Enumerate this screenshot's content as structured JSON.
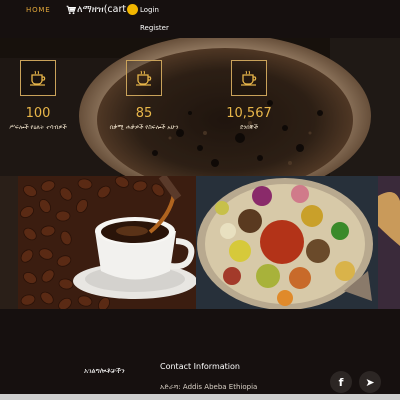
{
  "header": {
    "nav_home": "HOME",
    "cart_label": "ለማዘዝ(cart",
    "cart_icon": "cart-icon",
    "login": "Login",
    "register": "Register",
    "accent_color": "#e0a63a",
    "badge_color": "#f2b600"
  },
  "stats": [
    {
      "icon": "coffee-cup-icon",
      "value": "100",
      "label": "ሥፍሎች የዕለት ተሳብዎች"
    },
    {
      "icon": "coffee-cup-icon",
      "value": "85",
      "label": "በቃሚ ሐቃዎች የስፍሎች አሁን"
    },
    {
      "icon": "coffee-cup-icon",
      "value": "10,567",
      "label": "ደንበኞች"
    }
  ],
  "gallery": {
    "left_image": "coffee-cup-and-beans-image",
    "right_image": "ethiopian-food-platter-image"
  },
  "footer": {
    "links_title": "አገልግሎቶቻችን",
    "contact_title": "Contact Information",
    "contact_address": "አድራሻ: Addis Abeba Ethiopia",
    "social": [
      {
        "icon": "facebook-icon",
        "glyph": "f"
      },
      {
        "icon": "telegram-icon",
        "glyph": "➤"
      }
    ]
  }
}
